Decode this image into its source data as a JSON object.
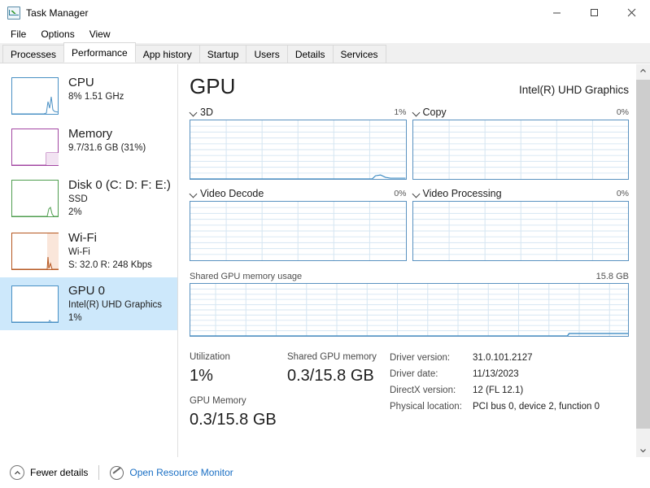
{
  "window": {
    "title": "Task Manager",
    "icon": "task-manager-icon",
    "controls": {
      "minimize": "─",
      "maximize": "□",
      "close": "✕"
    }
  },
  "menu": {
    "items": [
      "File",
      "Options",
      "View"
    ]
  },
  "tabs": {
    "items": [
      "Processes",
      "Performance",
      "App history",
      "Startup",
      "Users",
      "Details",
      "Services"
    ],
    "active": "Performance"
  },
  "sidebar": {
    "items": [
      {
        "title": "CPU",
        "sub1": "8%  1.51 GHz",
        "sub2": "",
        "color": "#4a90c4",
        "selected": false
      },
      {
        "title": "Memory",
        "sub1": "9.7/31.6 GB (31%)",
        "sub2": "",
        "color": "#a347a3",
        "selected": false
      },
      {
        "title": "Disk 0 (C: D: F: E:)",
        "sub1": "SSD",
        "sub2": "2%",
        "color": "#4f9e4f",
        "selected": false
      },
      {
        "title": "Wi-Fi",
        "sub1": "Wi-Fi",
        "sub2": "S: 32.0 R: 248 Kbps",
        "color": "#b5561f",
        "selected": false
      },
      {
        "title": "GPU 0",
        "sub1": "Intel(R) UHD Graphics",
        "sub2": "1%",
        "color": "#4a90c4",
        "selected": true
      }
    ]
  },
  "main": {
    "title": "GPU",
    "subtitle": "Intel(R) UHD Graphics",
    "graphs": [
      {
        "label": "3D",
        "value": "1%"
      },
      {
        "label": "Copy",
        "value": "0%"
      },
      {
        "label": "Video Decode",
        "value": "0%"
      },
      {
        "label": "Video Processing",
        "value": "0%"
      }
    ],
    "shared_memory_graph": {
      "label": "Shared GPU memory usage",
      "max": "15.8 GB"
    },
    "stats": {
      "utilization_label": "Utilization",
      "utilization_value": "1%",
      "gpu_memory_label": "GPU Memory",
      "gpu_memory_value": "0.3/15.8 GB",
      "shared_memory_label": "Shared GPU memory",
      "shared_memory_value": "0.3/15.8 GB"
    },
    "info": [
      {
        "key": "Driver version:",
        "val": "31.0.101.2127"
      },
      {
        "key": "Driver date:",
        "val": "11/13/2023"
      },
      {
        "key": "DirectX version:",
        "val": "12 (FL 12.1)"
      },
      {
        "key": "Physical location:",
        "val": "PCI bus 0, device 2, function 0"
      }
    ]
  },
  "statusbar": {
    "fewer_details": "Fewer details",
    "resource_monitor": "Open Resource Monitor",
    "link_color": "#1a6fc4"
  }
}
